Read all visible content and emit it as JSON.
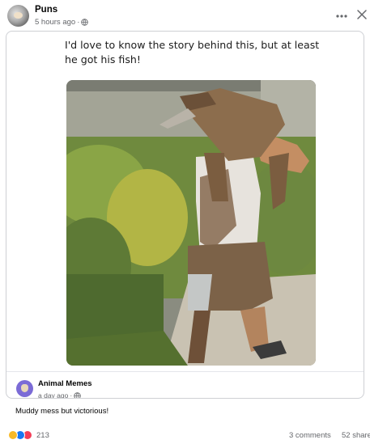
{
  "post": {
    "author": "Puns",
    "timestamp": "5 hours ago",
    "audience_icon": "globe-icon",
    "text": "Muddy mess but victorious!"
  },
  "shared_card": {
    "caption": "I'd love to know the story behind this, but at least he got his fish!",
    "image_description_icon": "photo"
  },
  "shared_from": {
    "author": "Animal Memes",
    "timestamp": "a day ago",
    "audience_icon": "globe-icon"
  },
  "stats": {
    "reaction_icons": [
      "haha-icon",
      "like-icon",
      "love-icon"
    ],
    "reaction_count": "213",
    "comments": "3 comments",
    "shares": "52 share"
  },
  "colors": {
    "secondary_text": "#65676b",
    "like_blue": "#1877f2",
    "love_red": "#f33e58",
    "haha_yellow": "#f7b928",
    "border": "#ced0d4"
  }
}
